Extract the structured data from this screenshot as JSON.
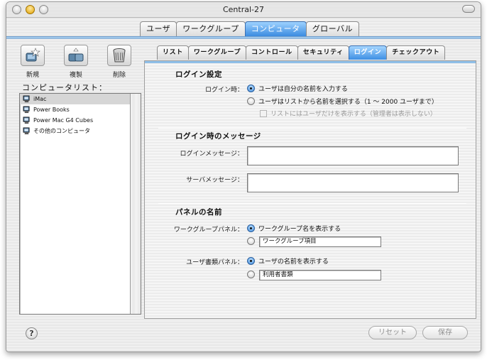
{
  "window": {
    "title": "Central-27"
  },
  "top_tabs": [
    {
      "label": "ユーザ"
    },
    {
      "label": "ワークグループ"
    },
    {
      "label": "コンピュータ",
      "active": true
    },
    {
      "label": "グローバル"
    }
  ],
  "toolbar": {
    "new_label": "新規",
    "duplicate_label": "複製",
    "delete_label": "削除"
  },
  "list": {
    "title": "コンピュータリスト：",
    "items": [
      {
        "label": "iMac",
        "selected": true
      },
      {
        "label": "Power Books"
      },
      {
        "label": "Power Mac G4 Cubes"
      },
      {
        "label": "その他のコンピュータ"
      }
    ]
  },
  "sub_tabs": [
    {
      "label": "リスト"
    },
    {
      "label": "ワークグループ"
    },
    {
      "label": "コントロール"
    },
    {
      "label": "セキュリティ"
    },
    {
      "label": "ログイン",
      "active": true
    },
    {
      "label": "チェックアウト"
    }
  ],
  "login": {
    "section_title": "ログイン設定",
    "when_label": "ログイン時：",
    "option_type_name": "ユーザは自分の名前を入力する",
    "option_select_list": "ユーザはリストから名前を選択する（1 〜 2000 ユーザまで）",
    "option_only_users": "リストにはユーザだけを表示する（管理者は表示しない）"
  },
  "messages": {
    "section_title": "ログイン時のメッセージ",
    "login_message_label": "ログインメッセージ：",
    "server_message_label": "サーバメッセージ：",
    "login_message_value": "",
    "server_message_value": ""
  },
  "panels": {
    "section_title": "パネルの名前",
    "workgroup_panel_label": "ワークグループパネル：",
    "workgroup_option_show_name": "ワークグループ名を表示する",
    "workgroup_custom_value": "ワークグループ項目",
    "user_docs_panel_label": "ユーザ書類パネル：",
    "user_docs_option_show_name": "ユーザの名前を表示する",
    "user_docs_custom_value": "利用者書類"
  },
  "footer": {
    "help_label": "?",
    "revert_label": "リセット",
    "save_label": "保存"
  },
  "colors": {
    "accent": "#3b8be0",
    "selection": "#d6d6d6"
  }
}
